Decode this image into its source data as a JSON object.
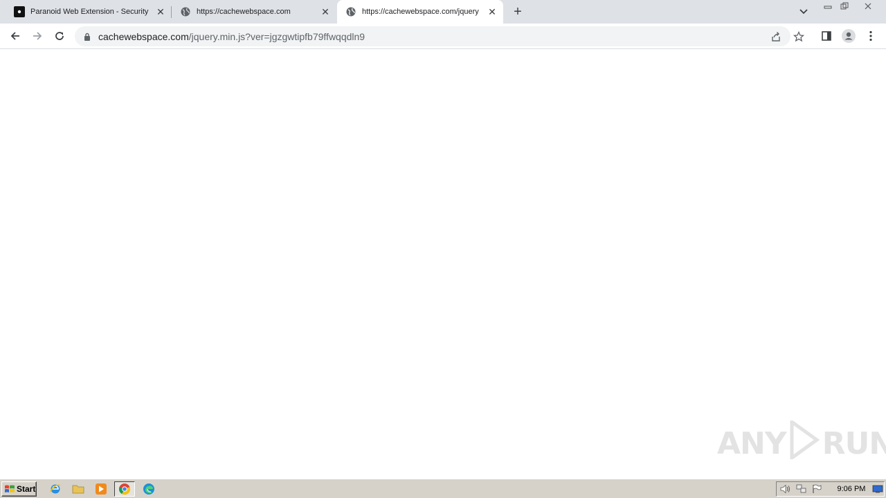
{
  "browser": {
    "tabs": [
      {
        "title": "Paranoid Web Extension - Security E",
        "favicon": "paranoid-logo-icon",
        "active": false
      },
      {
        "title": "https://cachewebspace.com",
        "favicon": "globe-icon",
        "active": false
      },
      {
        "title": "https://cachewebspace.com/jquery",
        "favicon": "globe-icon",
        "active": true
      }
    ],
    "new_tab_symbol": "+",
    "close_symbol": "✕"
  },
  "toolbar": {
    "url_host": "cachewebspace.com",
    "url_path": "/jquery.min.js?ver=jgzgwtipfb79ffwqqdln9"
  },
  "watermark": {
    "left": "ANY",
    "right": "RUN"
  },
  "taskbar": {
    "start_label": "Start",
    "clock": "9:06 PM"
  },
  "colors": {
    "tabstrip": "#dee1e6",
    "omnibox": "#f1f3f4",
    "taskbar": "#d6d2ca"
  }
}
